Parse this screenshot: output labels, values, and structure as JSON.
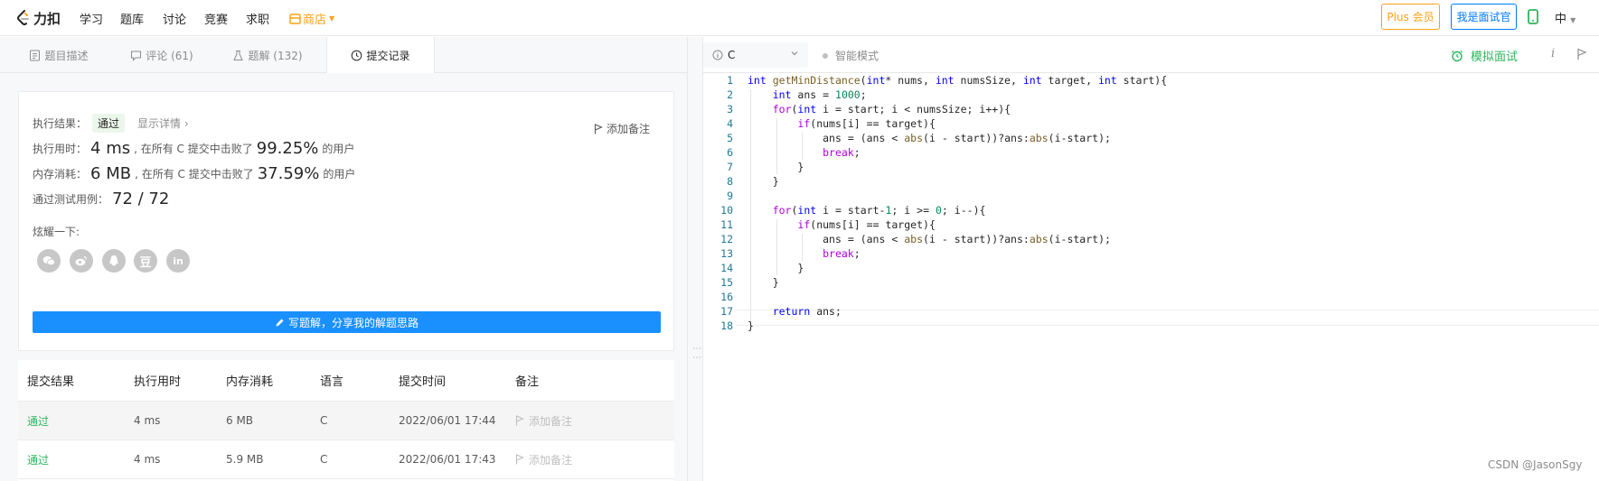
{
  "nav": {
    "logo": "力扣",
    "links": [
      "学习",
      "题库",
      "讨论",
      "竞赛",
      "求职"
    ],
    "store": "商店",
    "plus": "Plus 会员",
    "interviewer": "我是面试官",
    "lang": "中"
  },
  "tabs": [
    {
      "label": "题目描述"
    },
    {
      "label": "评论 (61)"
    },
    {
      "label": "题解 (132)"
    },
    {
      "label": "提交记录"
    }
  ],
  "result": {
    "exec_label": "执行结果：",
    "status": "通过",
    "detail": "显示详情",
    "add_note": "添加备注",
    "time_label": "执行用时：",
    "time_val": "4 ms",
    "time_text": ", 在所有 C 提交中击败了",
    "time_pct": "99.25%",
    "users": "的用户",
    "mem_label": "内存消耗：",
    "mem_val": "6 MB",
    "mem_text": ", 在所有 C 提交中击败了",
    "mem_pct": "37.59%",
    "cases_label": "通过测试用例：",
    "cases_val": "72 / 72",
    "share_label": "炫耀一下:",
    "write_btn": "写题解，分享我的解题思路"
  },
  "table": {
    "headers": [
      "提交结果",
      "执行用时",
      "内存消耗",
      "语言",
      "提交时间",
      "备注"
    ],
    "rows": [
      [
        "通过",
        "4 ms",
        "6 MB",
        "C",
        "2022/06/01 17:44",
        "添加备注"
      ],
      [
        "通过",
        "4 ms",
        "5.9 MB",
        "C",
        "2022/06/01 17:43",
        "添加备注"
      ]
    ]
  },
  "editor": {
    "lang": "C",
    "smart_mode": "智能模式",
    "mock": "模拟面试",
    "code_lines": [
      "int getMinDistance(int* nums, int numsSize, int target, int start){",
      "    int ans = 1000;",
      "    for(int i = start; i < numsSize; i++){",
      "        if(nums[i] == target){",
      "            ans = (ans < abs(i - start))?ans:abs(i-start);",
      "            break;",
      "        }",
      "    }",
      "",
      "    for(int i = start-1; i >= 0; i--){",
      "        if(nums[i] == target){",
      "            ans = (ans < abs(i - start))?ans:abs(i-start);",
      "            break;",
      "        }",
      "    }",
      "",
      "    return ans;",
      "}"
    ]
  },
  "watermark": "CSDN @JasonSgy",
  "colors": {
    "accent_orange": "#ffa116",
    "accent_blue": "#007aff",
    "pass_green": "#2db55d",
    "button_blue": "#1a90ff"
  }
}
